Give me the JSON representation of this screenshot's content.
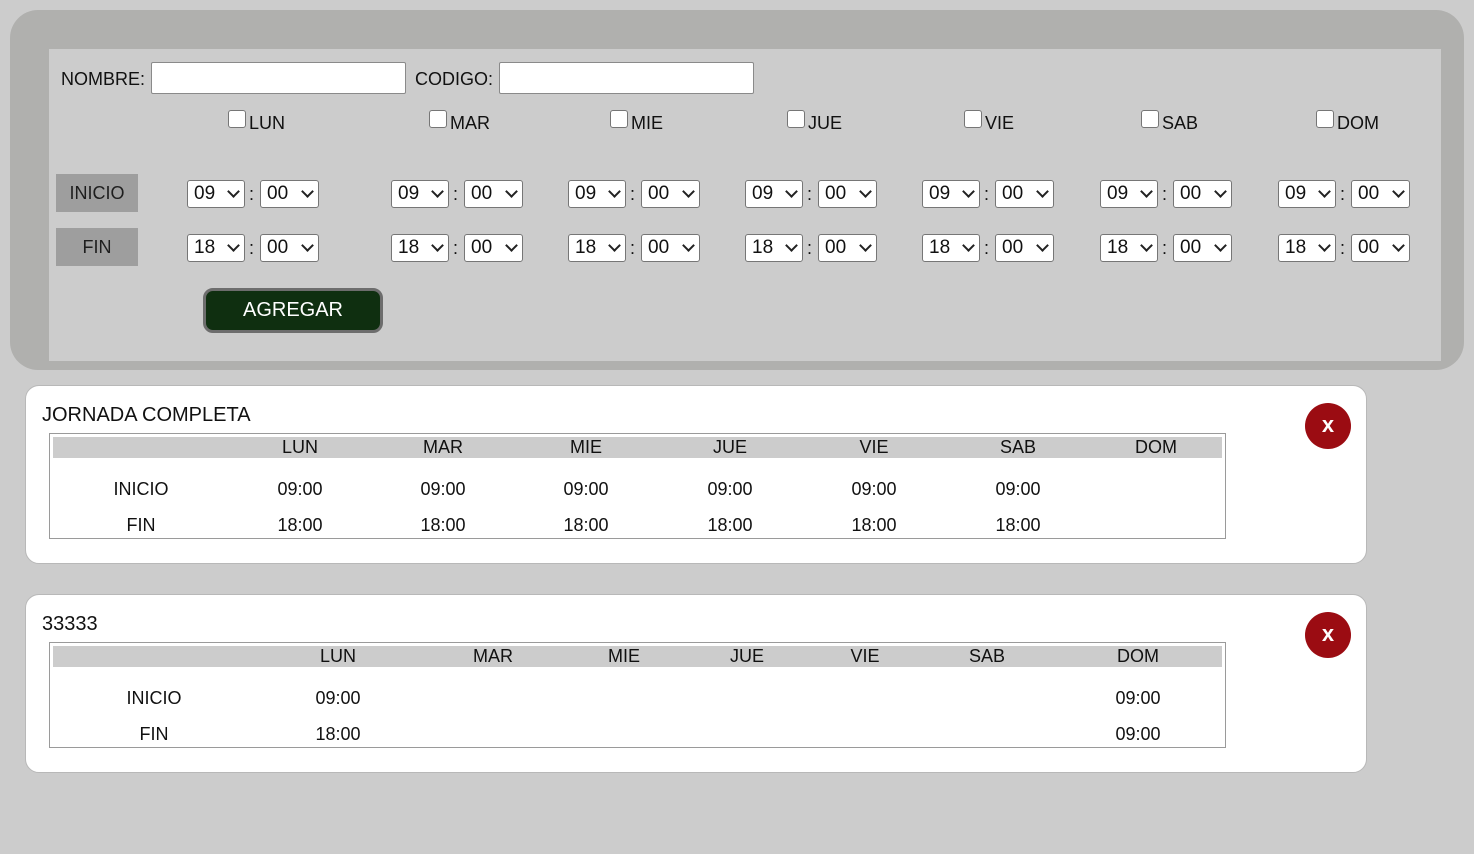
{
  "form": {
    "nombre_label": "NOMBRE:",
    "nombre_value": "",
    "codigo_label": "CODIGO:",
    "codigo_value": "",
    "inicio_label": "INICIO",
    "fin_label": "FIN",
    "separator": ":",
    "add_button": "AGREGAR",
    "days": [
      {
        "label": "LUN",
        "checked": false,
        "start_h": "09",
        "start_m": "00",
        "end_h": "18",
        "end_m": "00"
      },
      {
        "label": "MAR",
        "checked": false,
        "start_h": "09",
        "start_m": "00",
        "end_h": "18",
        "end_m": "00"
      },
      {
        "label": "MIE",
        "checked": false,
        "start_h": "09",
        "start_m": "00",
        "end_h": "18",
        "end_m": "00"
      },
      {
        "label": "JUE",
        "checked": false,
        "start_h": "09",
        "start_m": "00",
        "end_h": "18",
        "end_m": "00"
      },
      {
        "label": "VIE",
        "checked": false,
        "start_h": "09",
        "start_m": "00",
        "end_h": "18",
        "end_m": "00"
      },
      {
        "label": "SAB",
        "checked": false,
        "start_h": "09",
        "start_m": "00",
        "end_h": "18",
        "end_m": "00"
      },
      {
        "label": "DOM",
        "checked": false,
        "start_h": "09",
        "start_m": "00",
        "end_h": "18",
        "end_m": "00"
      }
    ]
  },
  "schedules": [
    {
      "title": "JORNADA COMPLETA",
      "delete_label": "x",
      "row_labels": [
        "INICIO",
        "FIN"
      ],
      "days": [
        "LUN",
        "MAR",
        "MIE",
        "JUE",
        "VIE",
        "SAB",
        "DOM"
      ],
      "inicio": [
        "09:00",
        "09:00",
        "09:00",
        "09:00",
        "09:00",
        "09:00",
        ""
      ],
      "fin": [
        "18:00",
        "18:00",
        "18:00",
        "18:00",
        "18:00",
        "18:00",
        ""
      ]
    },
    {
      "title": "33333",
      "delete_label": "x",
      "row_labels": [
        "INICIO",
        "FIN"
      ],
      "days": [
        "LUN",
        "MAR",
        "MIE",
        "JUE",
        "VIE",
        "SAB",
        "DOM"
      ],
      "inicio": [
        "09:00",
        "",
        "",
        "",
        "",
        "",
        "09:00"
      ],
      "fin": [
        "18:00",
        "",
        "",
        "",
        "",
        "",
        "09:00"
      ]
    }
  ]
}
